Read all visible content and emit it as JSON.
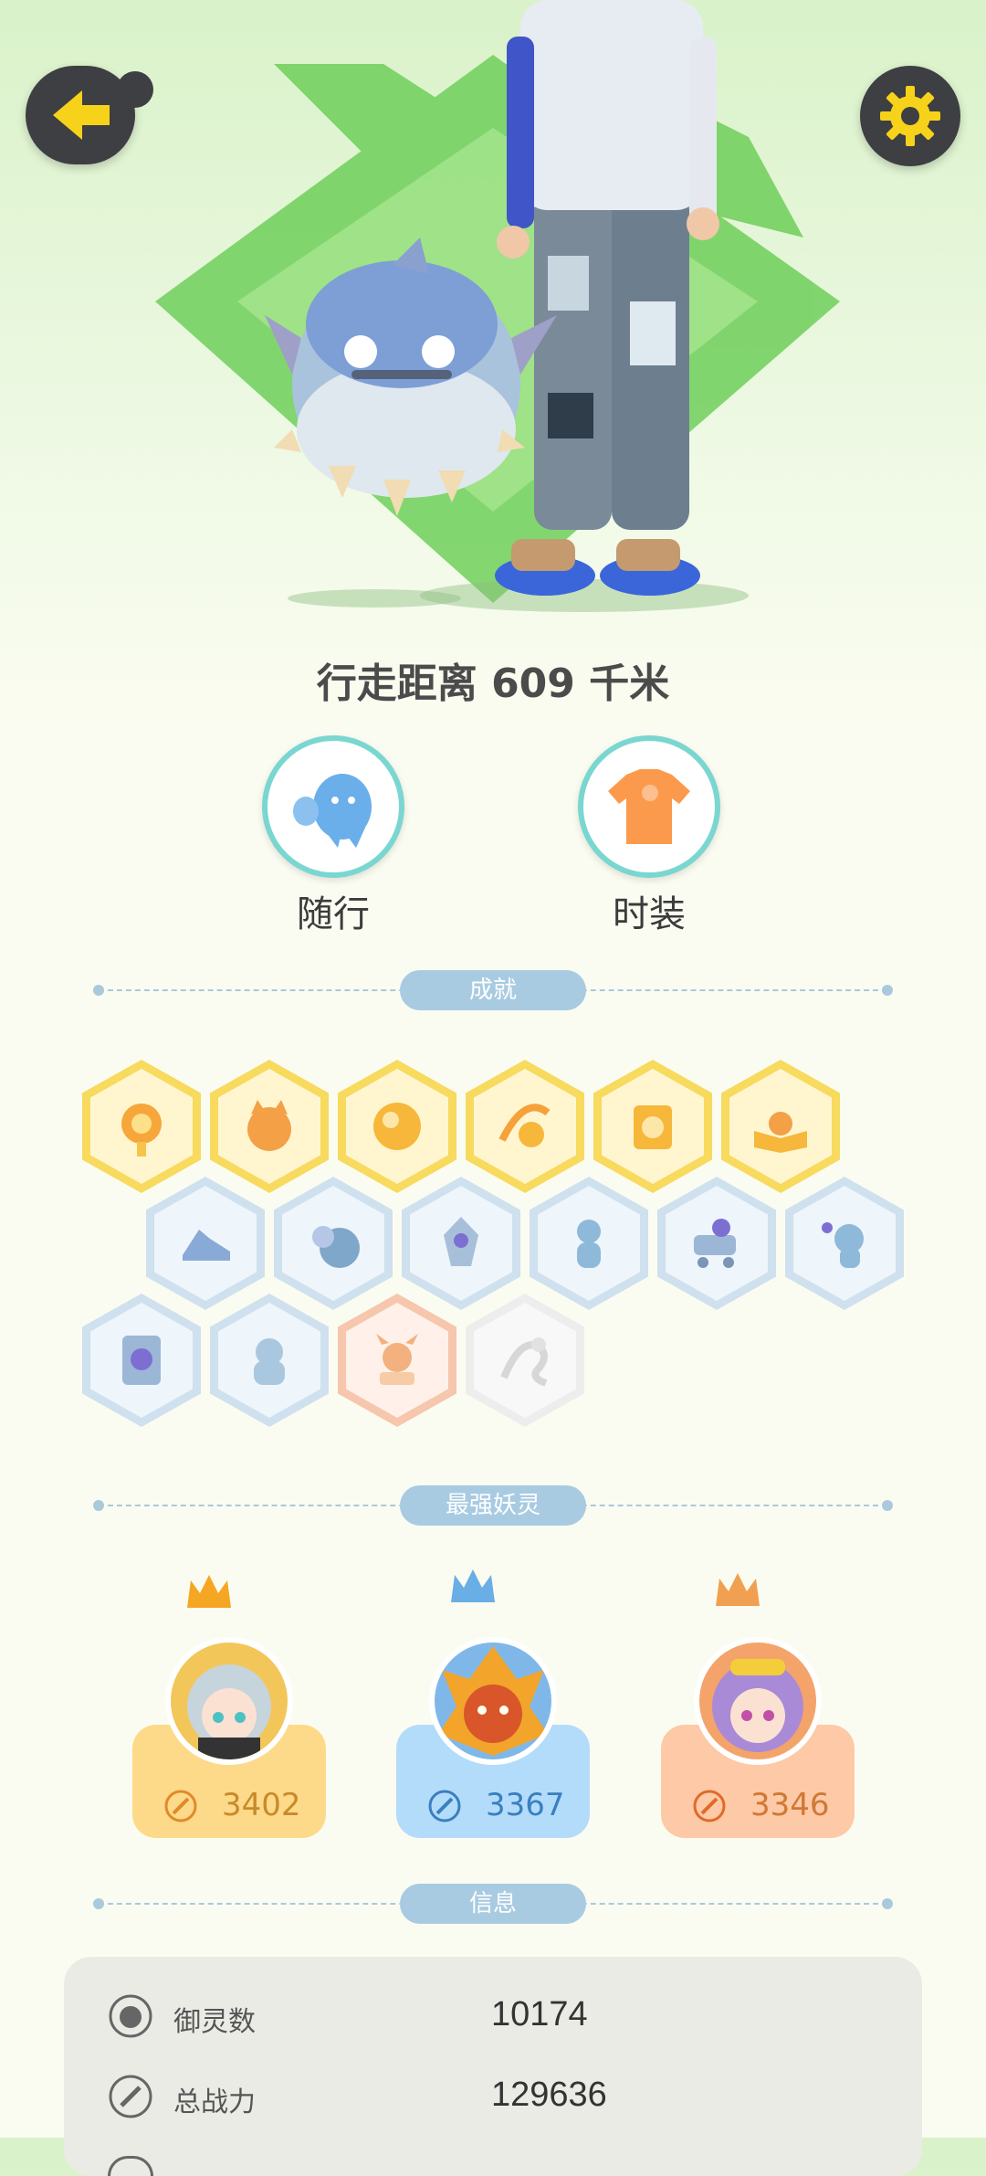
{
  "header": {
    "back_icon": "back-arrow-icon",
    "settings_icon": "gear-icon",
    "accent": "#f7d21a"
  },
  "profile": {
    "distance_text": "行走距离 609 千米"
  },
  "actions": [
    {
      "label": "随行",
      "icon": "companion-ghost-icon",
      "color": "#6aaeea"
    },
    {
      "label": "时装",
      "icon": "tshirt-icon",
      "color": "#fb9a4c"
    }
  ],
  "sections": {
    "achievements": "成就",
    "strongest": "最强妖灵",
    "info": "信息"
  },
  "achievement_badges": [
    {
      "tier": "gold",
      "icon": "sun-medal-icon"
    },
    {
      "tier": "gold",
      "icon": "fox-face-icon"
    },
    {
      "tier": "gold",
      "icon": "orb-icon"
    },
    {
      "tier": "gold",
      "icon": "yin-yang-swirl-icon"
    },
    {
      "tier": "gold",
      "icon": "yin-yang-book-icon"
    },
    {
      "tier": "gold",
      "icon": "open-book-fox-icon"
    },
    {
      "tier": "blue",
      "icon": "sneaker-icon"
    },
    {
      "tier": "blue",
      "icon": "moon-icon"
    },
    {
      "tier": "blue",
      "icon": "crystal-icon"
    },
    {
      "tier": "blue",
      "icon": "child-spirit-icon"
    },
    {
      "tier": "blue",
      "icon": "cat-stroller-icon"
    },
    {
      "tier": "blue",
      "icon": "cat-wand-icon"
    },
    {
      "tier": "blue",
      "icon": "scroll-banner-icon"
    },
    {
      "tier": "blue",
      "icon": "cat-back-icon"
    },
    {
      "tier": "orange",
      "icon": "ox-demon-icon"
    },
    {
      "tier": "faded",
      "icon": "dragon-icon"
    }
  ],
  "top_spirits": [
    {
      "power": "3402",
      "card_color": "#fdd98a",
      "text_color": "#c9892b",
      "crown_color": "#f5a623",
      "avatar": "silver-haired-girl-avatar"
    },
    {
      "power": "3367",
      "card_color": "#b3dcfb",
      "text_color": "#3a7fbf",
      "crown_color": "#6aaee6",
      "avatar": "flame-lion-avatar"
    },
    {
      "power": "3346",
      "card_color": "#fdc9a6",
      "text_color": "#d07836",
      "crown_color": "#f0a050",
      "avatar": "purple-haired-girl-avatar"
    }
  ],
  "info_rows": [
    {
      "label": "御灵数",
      "value": "10174",
      "icon": "spirit-face-icon"
    },
    {
      "label": "总战力",
      "value": "129636",
      "icon": "sword-icon"
    }
  ]
}
